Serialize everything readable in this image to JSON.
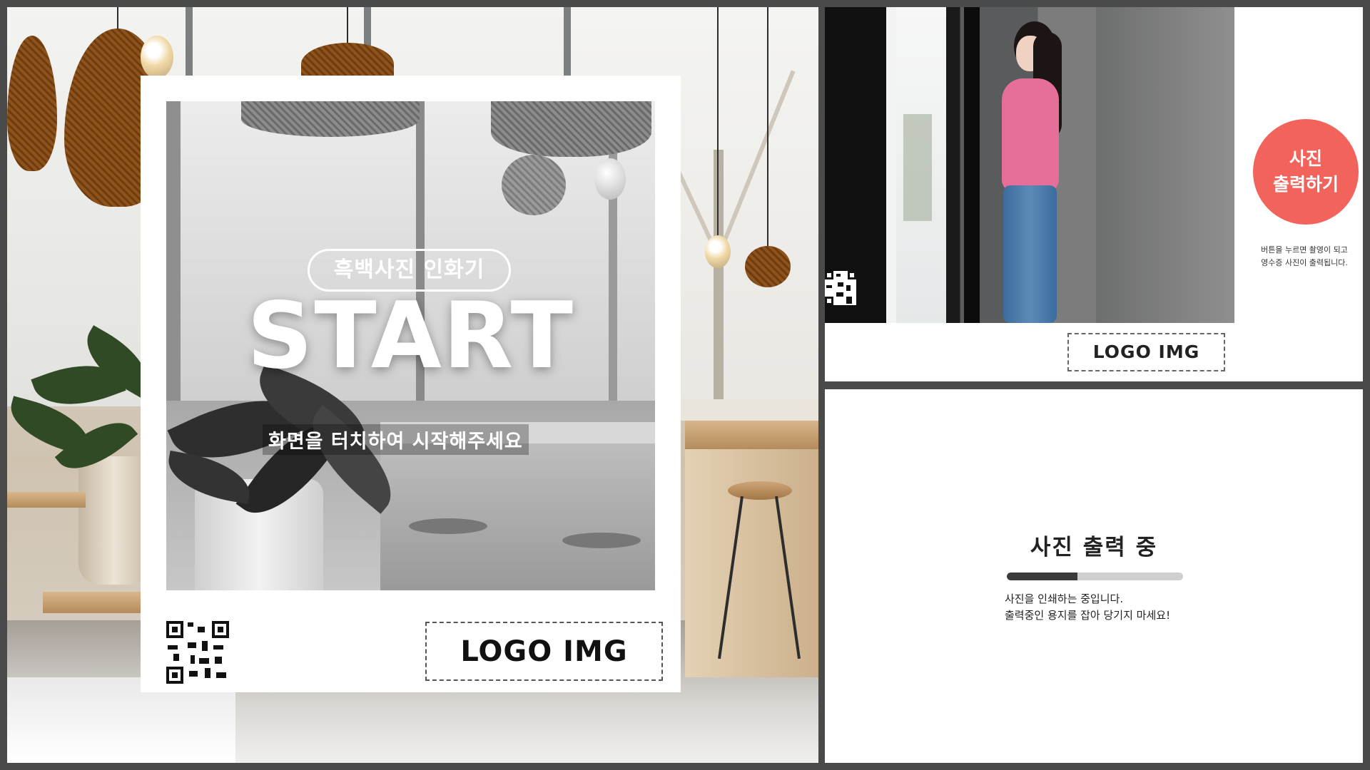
{
  "start_screen": {
    "pill_label": "흑백사진 인화기",
    "headline": "START",
    "instruction": "화면을 터치하여 시작해주세요",
    "logo_placeholder": "LOGO IMG"
  },
  "capture_screen": {
    "print_button_line1": "사진",
    "print_button_line2": "출력하기",
    "help_line1": "버튼을 누르면 촬영이 되고",
    "help_line2": "영수증 사진이 출력됩니다.",
    "logo_placeholder": "LOGO IMG"
  },
  "printing_screen": {
    "title": "사진 출력 중",
    "progress": 0.4,
    "message_line1": "사진을 인쇄하는 중입니다.",
    "message_line2": "출력중인 용지를 잡아 당기지 마세요!"
  },
  "colors": {
    "accent": "#f2645b",
    "progress_fill": "#3a3a3a",
    "progress_track": "#cfcfcf",
    "frame_background": "#4a4a4a"
  },
  "icons": {
    "qr": "qr-code-icon"
  }
}
